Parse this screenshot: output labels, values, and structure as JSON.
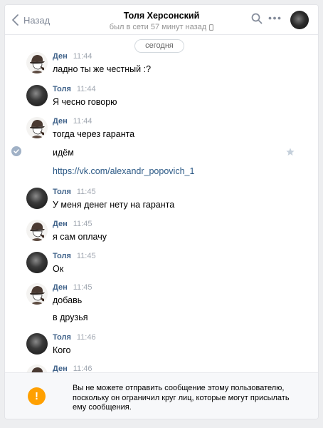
{
  "header": {
    "back_label": "Назад",
    "title": "Толя Херсонский",
    "status": "был в сети 57 минут назад"
  },
  "date_divider": "сегодня",
  "messages": [
    {
      "author": "Ден",
      "time": "11:44",
      "lines": [
        "ладно ты же честный :?"
      ]
    },
    {
      "author": "Толя",
      "time": "11:44",
      "lines": [
        "Я чесно говорю"
      ]
    },
    {
      "author": "Ден",
      "time": "11:44",
      "lines": [
        "тогда через гаранта",
        "идём",
        "https://vk.com/alexandr_popovich_1"
      ]
    },
    {
      "author": "Толя",
      "time": "11:45",
      "lines": [
        "У меня денег нету на гаранта"
      ]
    },
    {
      "author": "Ден",
      "time": "11:45",
      "lines": [
        "я сам оплачу"
      ]
    },
    {
      "author": "Толя",
      "time": "11:45",
      "lines": [
        "Ок"
      ]
    },
    {
      "author": "Ден",
      "time": "11:45",
      "lines": [
        "добавь",
        "в друзья"
      ]
    },
    {
      "author": "Толя",
      "time": "11:46",
      "lines": [
        "Кого"
      ]
    },
    {
      "author": "Ден",
      "time": "11:46",
      "lines": []
    }
  ],
  "notice": {
    "icon": "!",
    "text": "Вы не можете отправить сообщение этому пользователю, поскольку он ограничил круг лиц, которые могут присылать ему сообщения."
  },
  "colors": {
    "accent": "#42648b",
    "link": "#2a5885",
    "warning": "#ffa000"
  }
}
